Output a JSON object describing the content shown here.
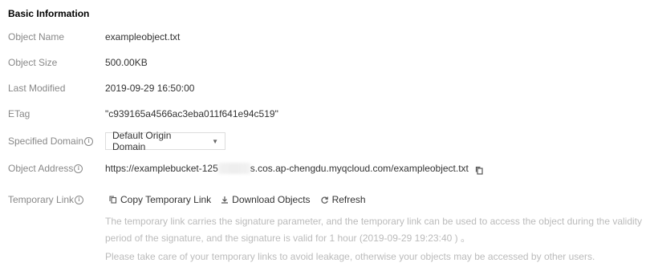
{
  "section": {
    "title": "Basic Information"
  },
  "fields": {
    "object_name": {
      "label": "Object Name",
      "value": "exampleobject.txt"
    },
    "object_size": {
      "label": "Object Size",
      "value": "500.00KB"
    },
    "last_modified": {
      "label": "Last Modified",
      "value": "2019-09-29 16:50:00"
    },
    "etag": {
      "label": "ETag",
      "value": "\"c939165a4566ac3eba011f641e94c519\""
    },
    "specified_domain": {
      "label": "Specified Domain",
      "selected": "Default Origin Domain"
    },
    "object_address": {
      "label": "Object Address",
      "url_prefix": "https://examplebucket-125",
      "url_suffix": "s.cos.ap-chengdu.myqcloud.com/exampleobject.txt"
    },
    "temporary_link": {
      "label": "Temporary Link"
    }
  },
  "actions": {
    "copy_label": "Copy Temporary Link",
    "download_label": "Download Objects",
    "refresh_label": "Refresh"
  },
  "notes": {
    "line1": "The temporary link carries the signature parameter, and the temporary link can be used to access the object during the validity period of the signature, and the signature is valid for 1 hour (2019-09-29 19:23:40 ) 。",
    "line2": "Please take care of your temporary links to avoid leakage, otherwise your objects may be accessed by other users."
  },
  "icons": {
    "info": "info-icon",
    "copy": "copy-icon",
    "download": "download-icon",
    "refresh": "refresh-icon",
    "dropdown": "caret-down-icon"
  },
  "colors": {
    "label": "#888888",
    "value": "#333333",
    "note": "#bbbbbb",
    "border": "#dddddd"
  }
}
